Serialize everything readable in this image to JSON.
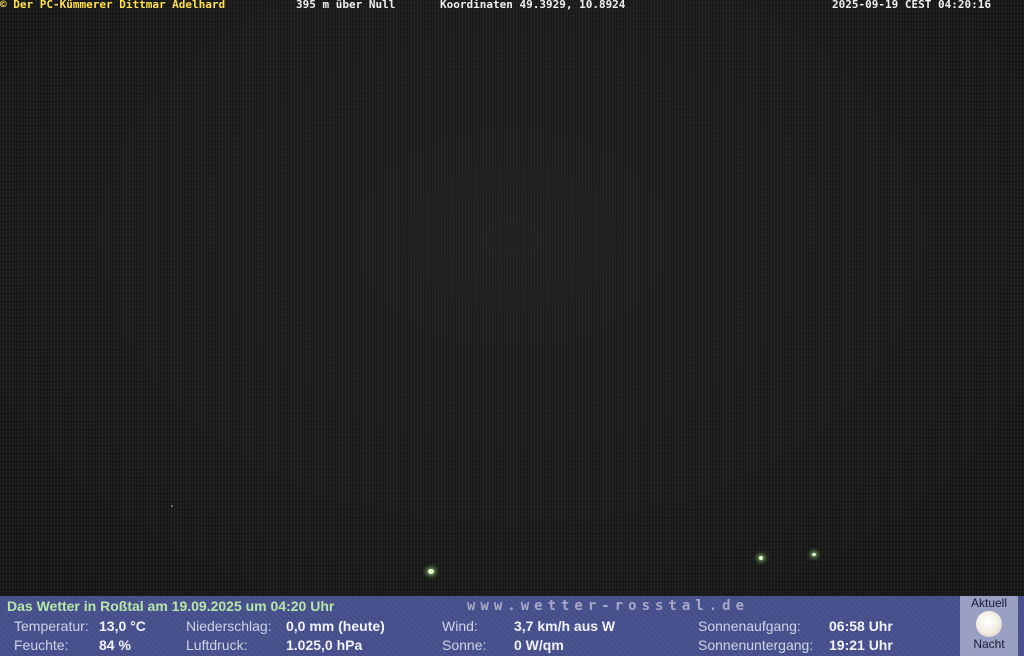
{
  "header": {
    "copyright": "© Der PC-Kümmerer Dittmar Adelhard",
    "altitude": "395 m über Null",
    "coordinates": "Koordinaten 49.3929, 10.8924",
    "timestamp": "2025-09-19 CEST 04:20:16"
  },
  "weather": {
    "title": "Das Wetter in Roßtal am 19.09.2025 um 04:20 Uhr",
    "website": "www.wetter-rosstal.de",
    "temperature_label": "Temperatur:",
    "temperature_value": "13,0 °C",
    "humidity_label": "Feuchte:",
    "humidity_value": "84 %",
    "precip_label": "Niederschlag:",
    "precip_value": "0,0 mm (heute)",
    "pressure_label": "Luftdruck:",
    "pressure_value": "1.025,0 hPa",
    "wind_label": "Wind:",
    "wind_value": "3,7 km/h aus W",
    "sun_label": "Sonne:",
    "sun_value": "0 W/qm",
    "sunrise_label": "Sonnenaufgang:",
    "sunrise_value": "06:58 Uhr",
    "sunset_label": "Sonnenuntergang:",
    "sunset_value": "19:21 Uhr",
    "moon_top": "Aktuell",
    "moon_bottom": "Nacht",
    "moon_icon": "full-moon-icon"
  },
  "colors": {
    "header_yellow": "#ffe14a",
    "bar_background": "#454e8a",
    "title_green": "#b8e6a8"
  }
}
